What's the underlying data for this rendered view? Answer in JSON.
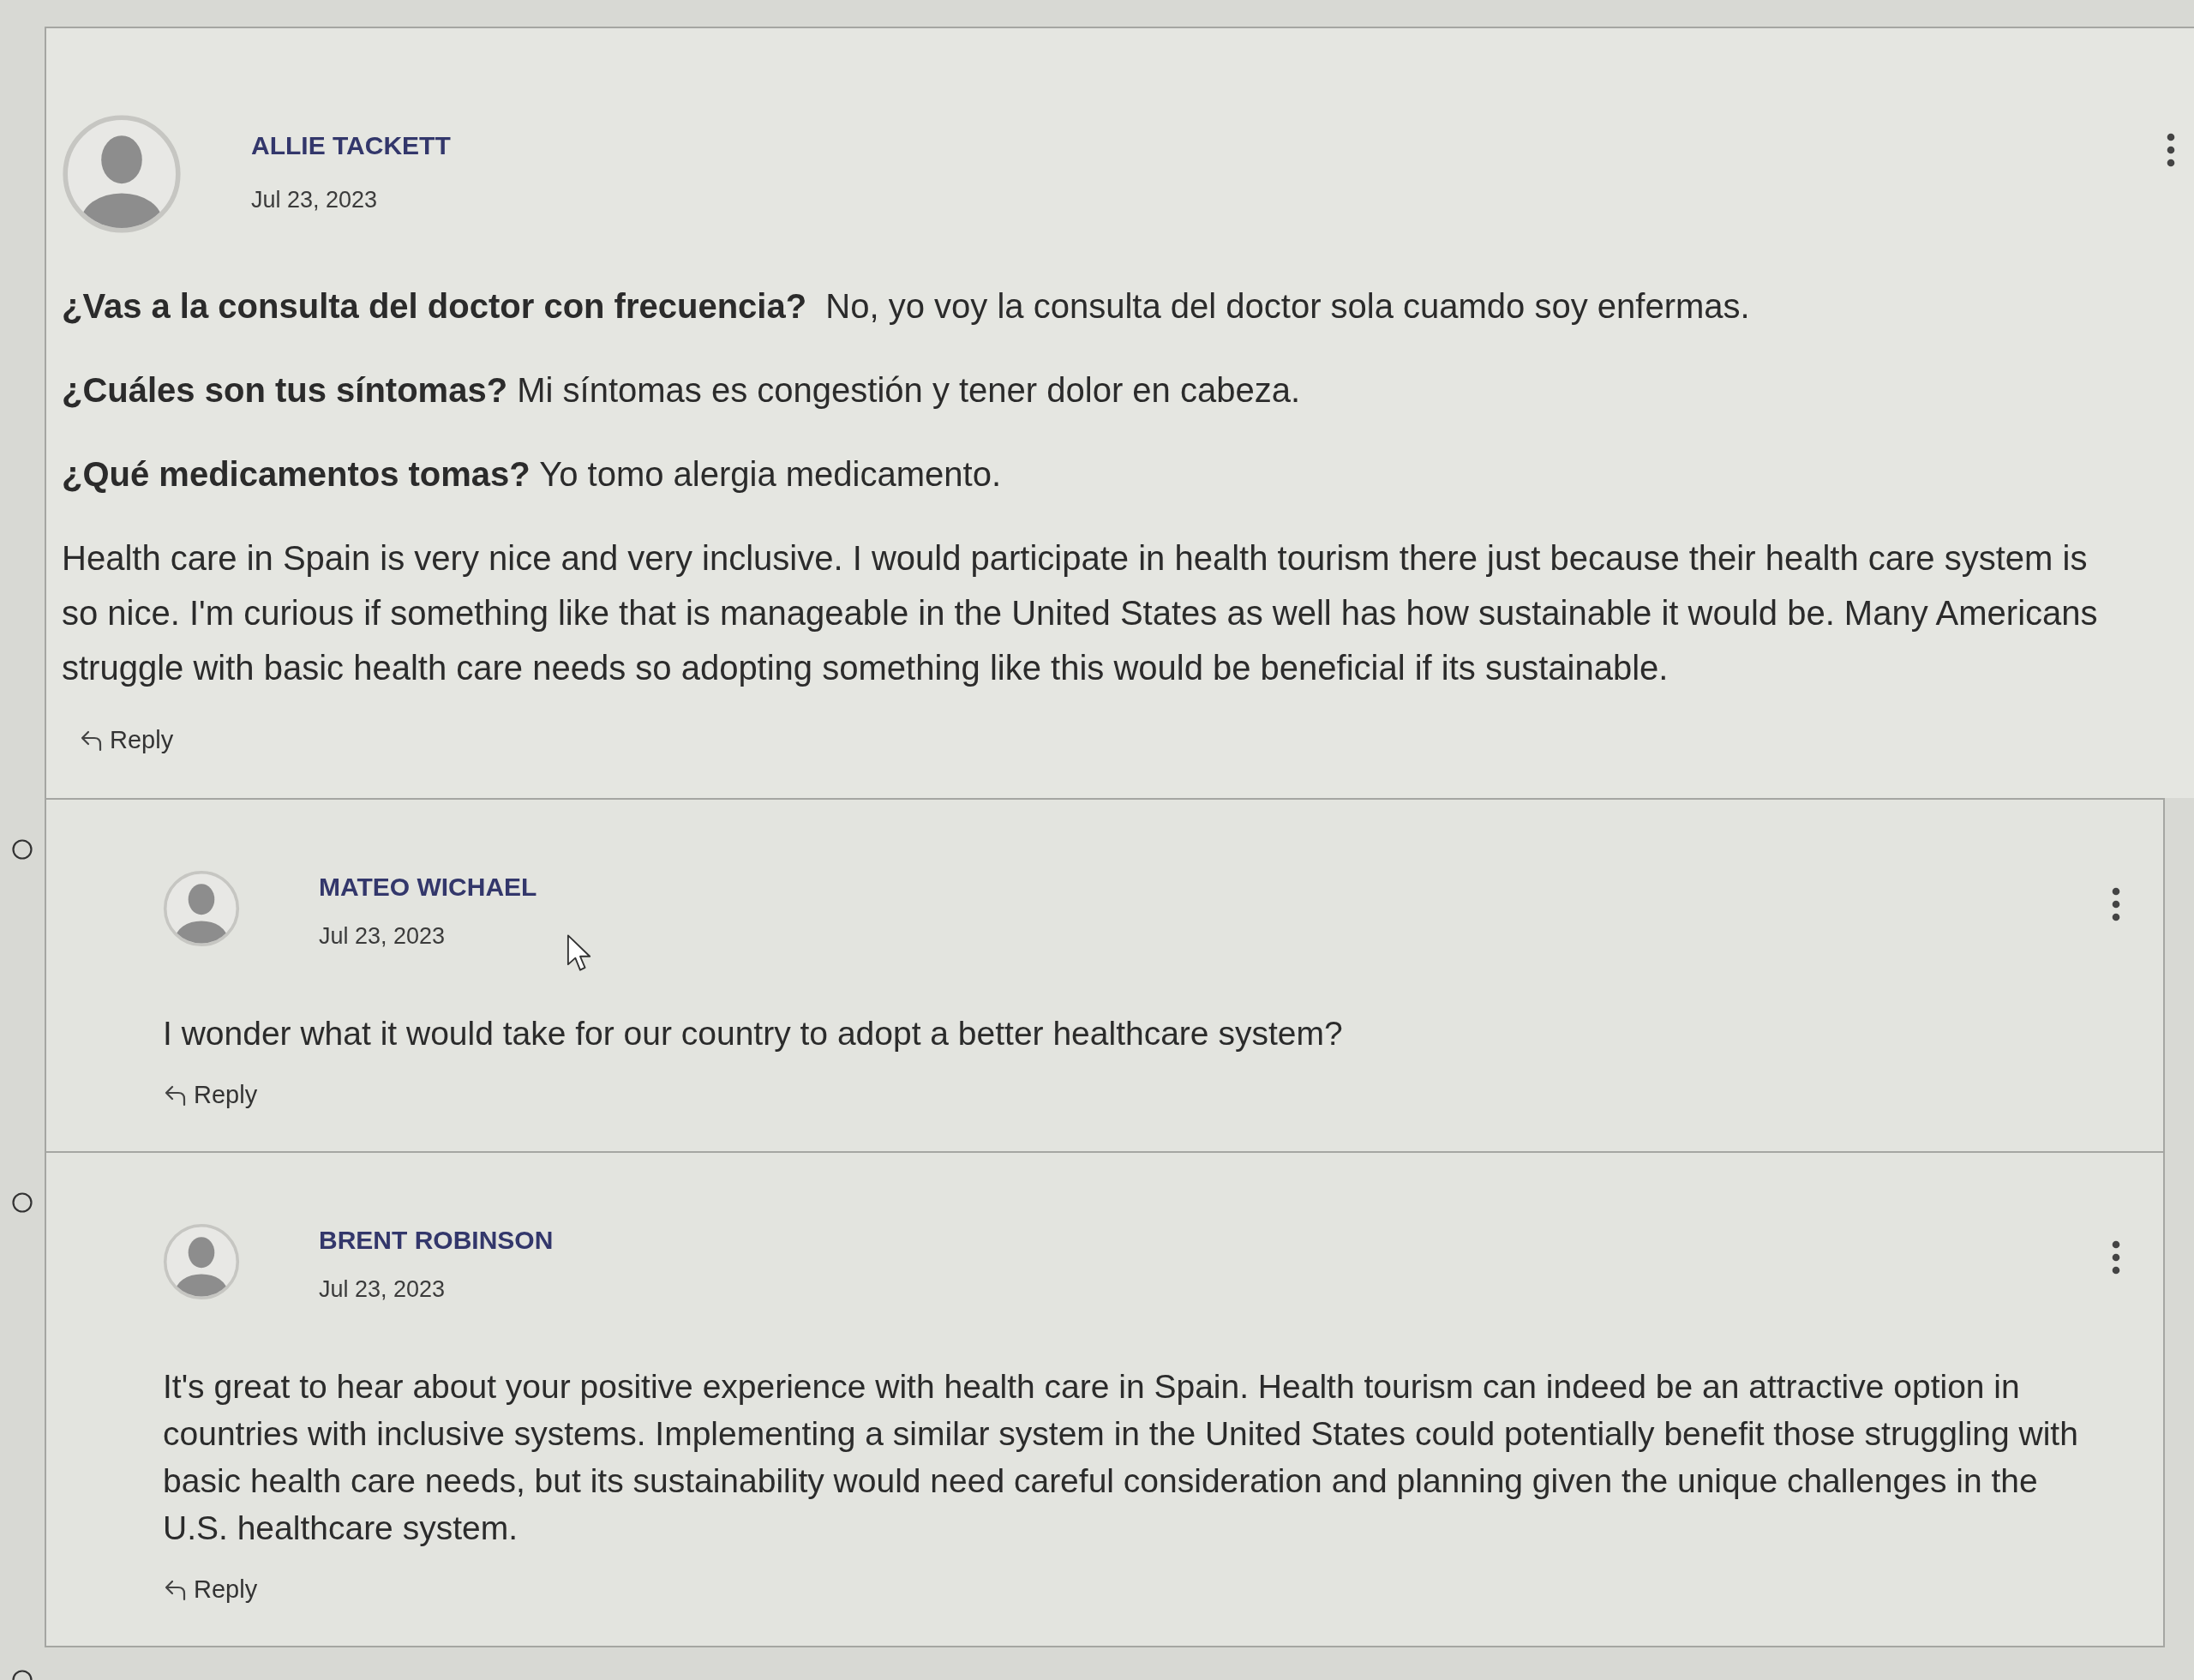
{
  "comments": [
    {
      "author": "ALLIE TACKETT",
      "date": "Jul 23, 2023",
      "paragraphs": [
        "**¿Vas a la consulta del doctor con frecuencia?**  No, yo voy la consulta del doctor sola cuamdo soy enfermas.",
        "**¿Cuáles son tus síntomas?** Mi síntomas es congestión y tener dolor en cabeza.",
        "**¿Qué medicamentos tomas?** Yo tomo alergia medicamento.",
        "Health care in Spain is very nice and very inclusive. I would participate in health tourism there just because their health care system is so nice. I'm curious if something like that is manageable in the United States as well has how sustainable it would be. Many Americans struggle with basic health care needs so adopting something like this would be beneficial if its sustainable."
      ],
      "reply_action": "Reply",
      "children": [
        {
          "author": "MATEO WICHAEL",
          "date": "Jul 23, 2023",
          "paragraphs": [
            "I wonder what it would take for our country to adopt a better healthcare system?"
          ],
          "reply_action": "Reply"
        },
        {
          "author": "BRENT ROBINSON",
          "date": "Jul 23, 2023",
          "paragraphs": [
            "It's great to hear about your positive experience with health care in Spain. Health tourism can indeed be an attractive option in countries with inclusive systems. Implementing a similar system in the United States could potentially benefit those struggling with basic health care needs, but its sustainability would need careful consideration and planning given the unique challenges in the U.S. healthcare system."
          ],
          "reply_action": "Reply"
        }
      ]
    }
  ]
}
